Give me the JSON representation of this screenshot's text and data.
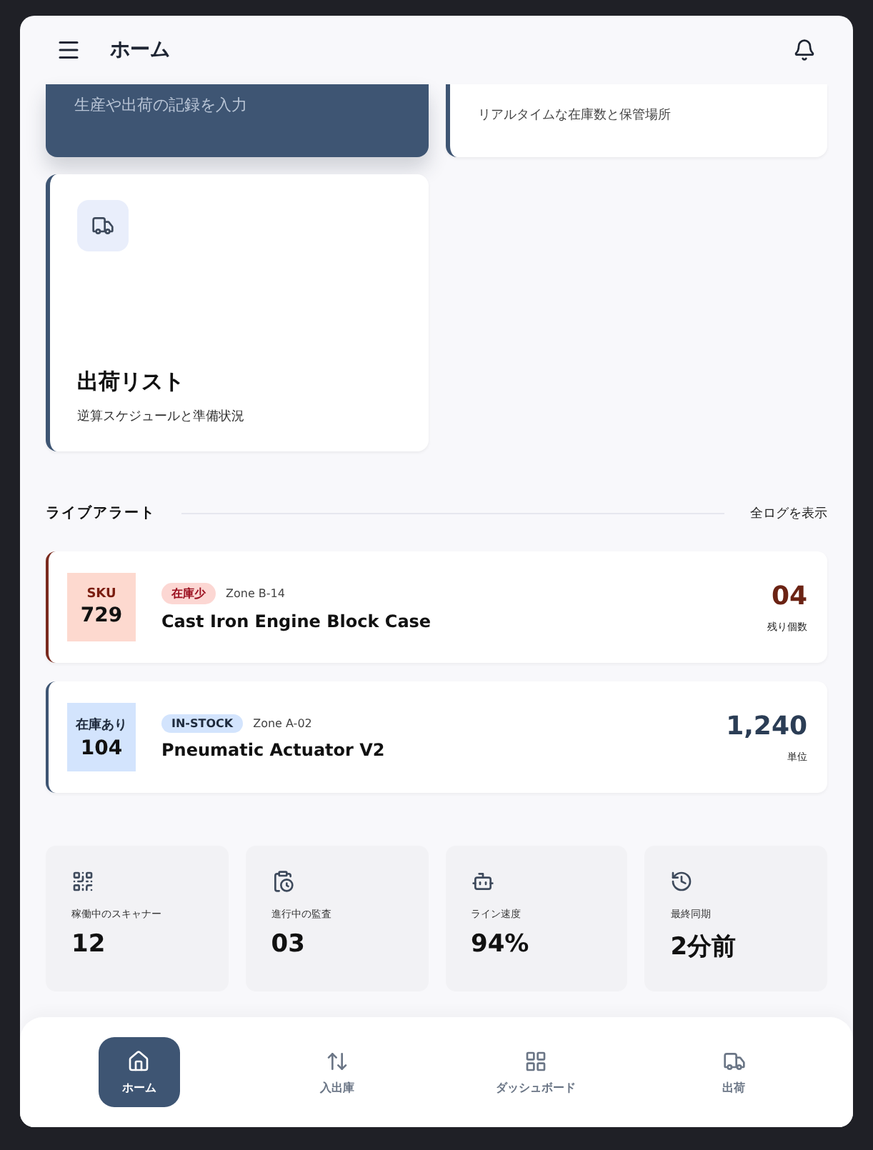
{
  "header": {
    "title": "ホーム"
  },
  "top_cards": [
    {
      "kind": "primary",
      "subtitle": "生産や出荷の記録を入力"
    },
    {
      "kind": "plain",
      "subtitle": "リアルタイムな在庫数と保管場所"
    }
  ],
  "shipping_card": {
    "title": "出荷リスト",
    "subtitle": "逆算スケジュールと準備状況"
  },
  "alerts_section": {
    "title": "ライブアラート",
    "link": "全ログを表示"
  },
  "alerts": [
    {
      "kind": "low",
      "code_label": "SKU",
      "code": "729",
      "tag": "在庫少",
      "zone": "Zone B-14",
      "name": "Cast Iron Engine Block Case",
      "count": "04",
      "unit": "残り個数"
    },
    {
      "kind": "ok",
      "code_label": "在庫あり",
      "code": "104",
      "tag": "IN-STOCK",
      "zone": "Zone A-02",
      "name": "Pneumatic Actuator V2",
      "count": "1,240",
      "unit": "単位"
    }
  ],
  "stats": [
    {
      "kind": "scanner",
      "label": "稼働中のスキャナー",
      "value": "12"
    },
    {
      "kind": "audit",
      "label": "進行中の監査",
      "value": "03"
    },
    {
      "kind": "line",
      "label": "ライン速度",
      "value": "94%"
    },
    {
      "kind": "sync",
      "label": "最終同期",
      "value": "2分前"
    }
  ],
  "nav": [
    {
      "kind": "home",
      "label": "ホーム",
      "selected": true
    },
    {
      "kind": "inout",
      "label": "入出庫",
      "selected": false
    },
    {
      "kind": "dashboard",
      "label": "ダッシュボード",
      "selected": false
    },
    {
      "kind": "shipping",
      "label": "出荷",
      "selected": false
    }
  ]
}
